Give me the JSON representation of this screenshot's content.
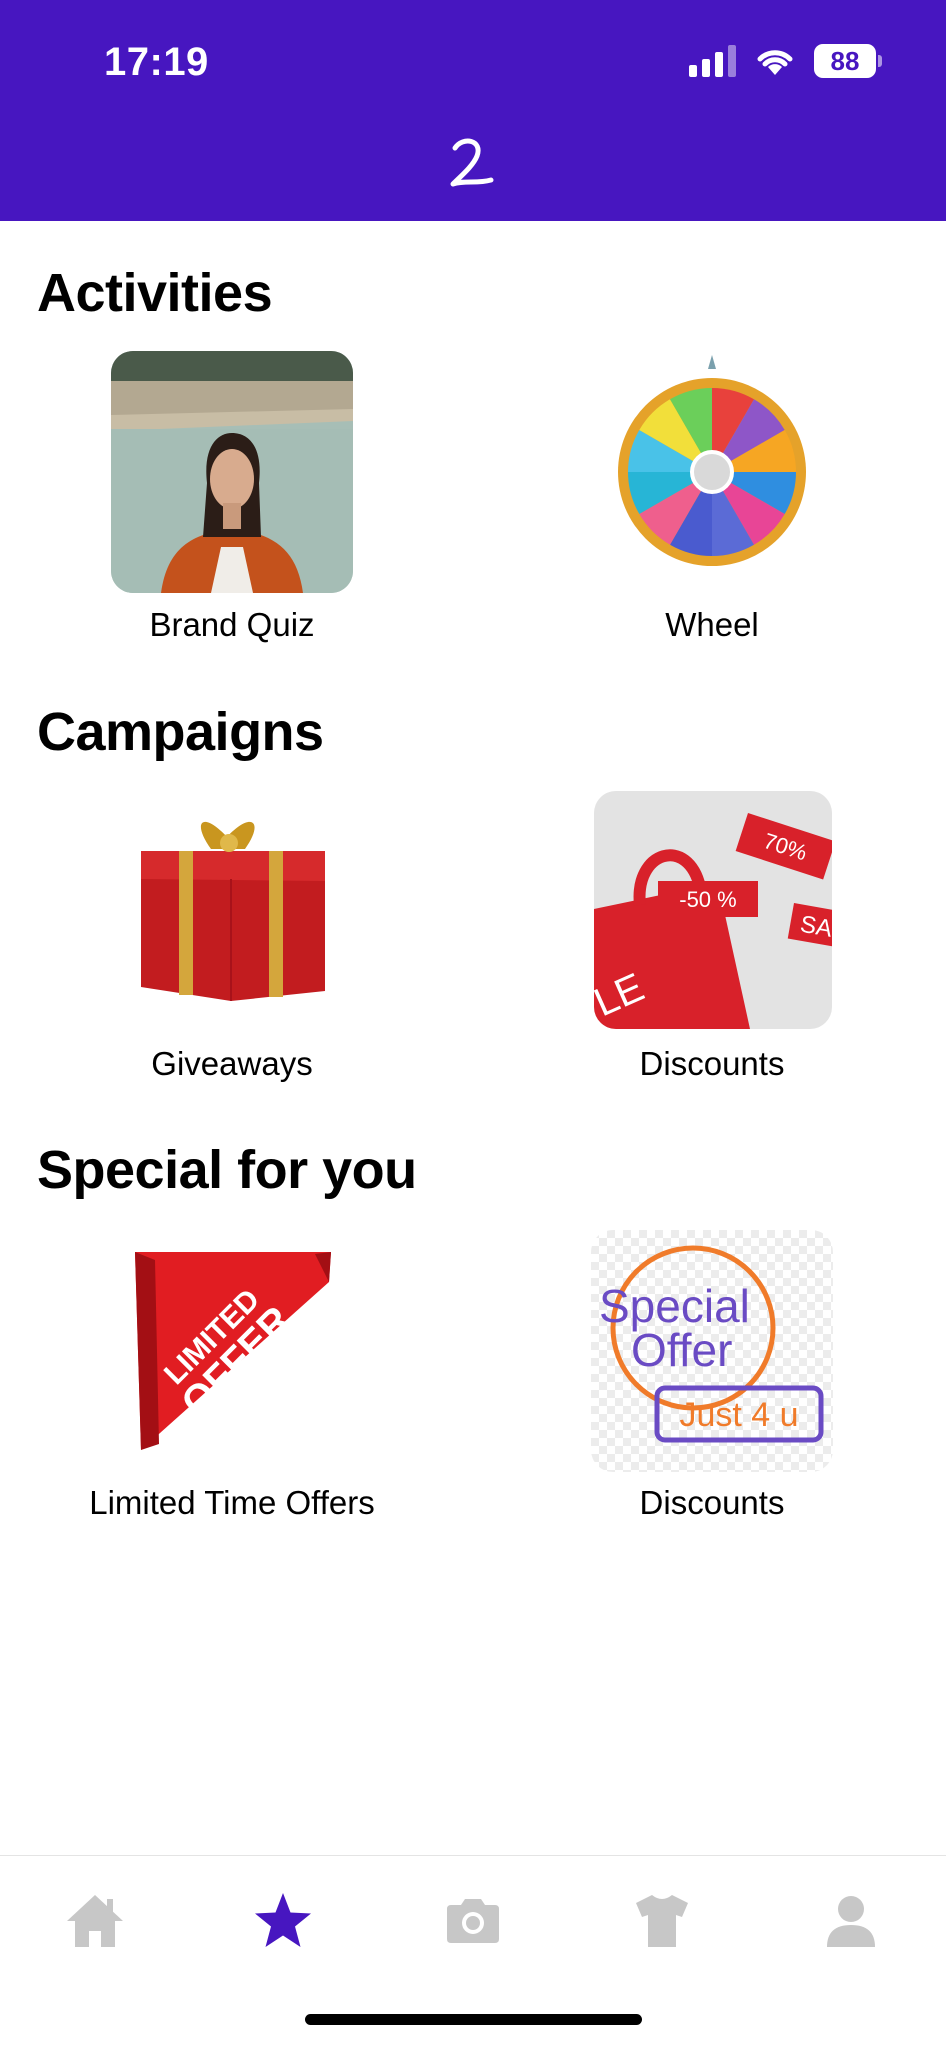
{
  "status_bar": {
    "time": "17:19",
    "battery": "88"
  },
  "sections": [
    {
      "title": "Activities",
      "tiles": [
        {
          "label": "Brand Quiz",
          "icon": "brand-quiz-photo"
        },
        {
          "label": "Wheel",
          "icon": "prize-wheel-icon"
        }
      ]
    },
    {
      "title": "Campaigns",
      "tiles": [
        {
          "label": "Giveaways",
          "icon": "gift-box-icon"
        },
        {
          "label": "Discounts",
          "icon": "sale-bag-photo",
          "tags": [
            "70%",
            "-50 %",
            "SA",
            "LE"
          ]
        }
      ]
    },
    {
      "title": "Special for you",
      "tiles": [
        {
          "label": "Limited Time Offers",
          "icon": "limited-offer-ribbon",
          "lines": [
            "LIMITED",
            "OFFER"
          ]
        },
        {
          "label": "Discounts",
          "icon": "special-offer-stamp",
          "lines": [
            "Special",
            "Offer",
            "Just 4 u"
          ]
        }
      ]
    }
  ],
  "bottom_nav": [
    {
      "name": "home",
      "icon": "home-icon",
      "active": false
    },
    {
      "name": "favorites",
      "icon": "star-icon",
      "active": true
    },
    {
      "name": "camera",
      "icon": "camera-icon",
      "active": false
    },
    {
      "name": "clothing",
      "icon": "shirt-icon",
      "active": false
    },
    {
      "name": "profile",
      "icon": "person-icon",
      "active": false
    }
  ],
  "colors": {
    "brand": "#4716c0",
    "nav_inactive": "#c7c7c7"
  }
}
